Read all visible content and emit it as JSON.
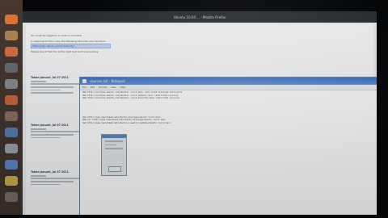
{
  "window": {
    "title": "Ubuntu 10.04 ... - Mozilla Firefox"
  },
  "page": {
    "notice_top": "You must be logged in to post a comment.",
    "notice_sub": "In response to this, copy the following text into your terminal:",
    "link_text": "https://help.ubuntu.com/community/...",
    "notice_after_link": "Please check that this is the right text before executing.",
    "entries": [
      {
        "title": "Tahan Januari, Jul 07 2011"
      },
      {
        "title": "Tahan Januari, Jul 07 2011"
      },
      {
        "title": "Tahan Januari, Jul 07 2011"
      }
    ]
  },
  "notepad": {
    "title": "sources.list - Notepad",
    "menu": [
      "File",
      "Edit",
      "Format",
      "View",
      "Help"
    ],
    "lines": [
      "deb http://archive.ubuntu.com/ubuntu/ lucid main restricted universe multiverse",
      "deb http://archive.ubuntu.com/ubuntu/ lucid-updates main restricted universe",
      "deb http://archive.ubuntu.com/ubuntu/ lucid-security main restricted universe",
      "",
      "deb http://ppa.launchpad.net/ubuntu-wine/ppa/ubuntu lucid main",
      "deb-src http://ppa.launchpad.net/ubuntu-wine/ppa/ubuntu lucid main",
      "deb http://ppa.launchpad.net/ubuntu-x-swat/x-updates/ubuntu lucid main"
    ]
  },
  "launcher_icons": [
    {
      "name": "firefox-icon",
      "color": "#e8793a"
    },
    {
      "name": "files-icon",
      "color": "#b58a5a"
    },
    {
      "name": "software-center-icon",
      "color": "#d9734a"
    },
    {
      "name": "terminal-icon",
      "color": "#6a6f76"
    },
    {
      "name": "settings-icon",
      "color": "#8b8f95"
    },
    {
      "name": "music-icon",
      "color": "#c76a3d"
    },
    {
      "name": "photos-icon",
      "color": "#8d7060"
    },
    {
      "name": "office-icon",
      "color": "#5a7fb0"
    },
    {
      "name": "mail-icon",
      "color": "#9aa3ad"
    },
    {
      "name": "chat-icon",
      "color": "#5d86c6"
    },
    {
      "name": "update-icon",
      "color": "#c8b050"
    },
    {
      "name": "trash-icon",
      "color": "#7b6f66"
    }
  ]
}
